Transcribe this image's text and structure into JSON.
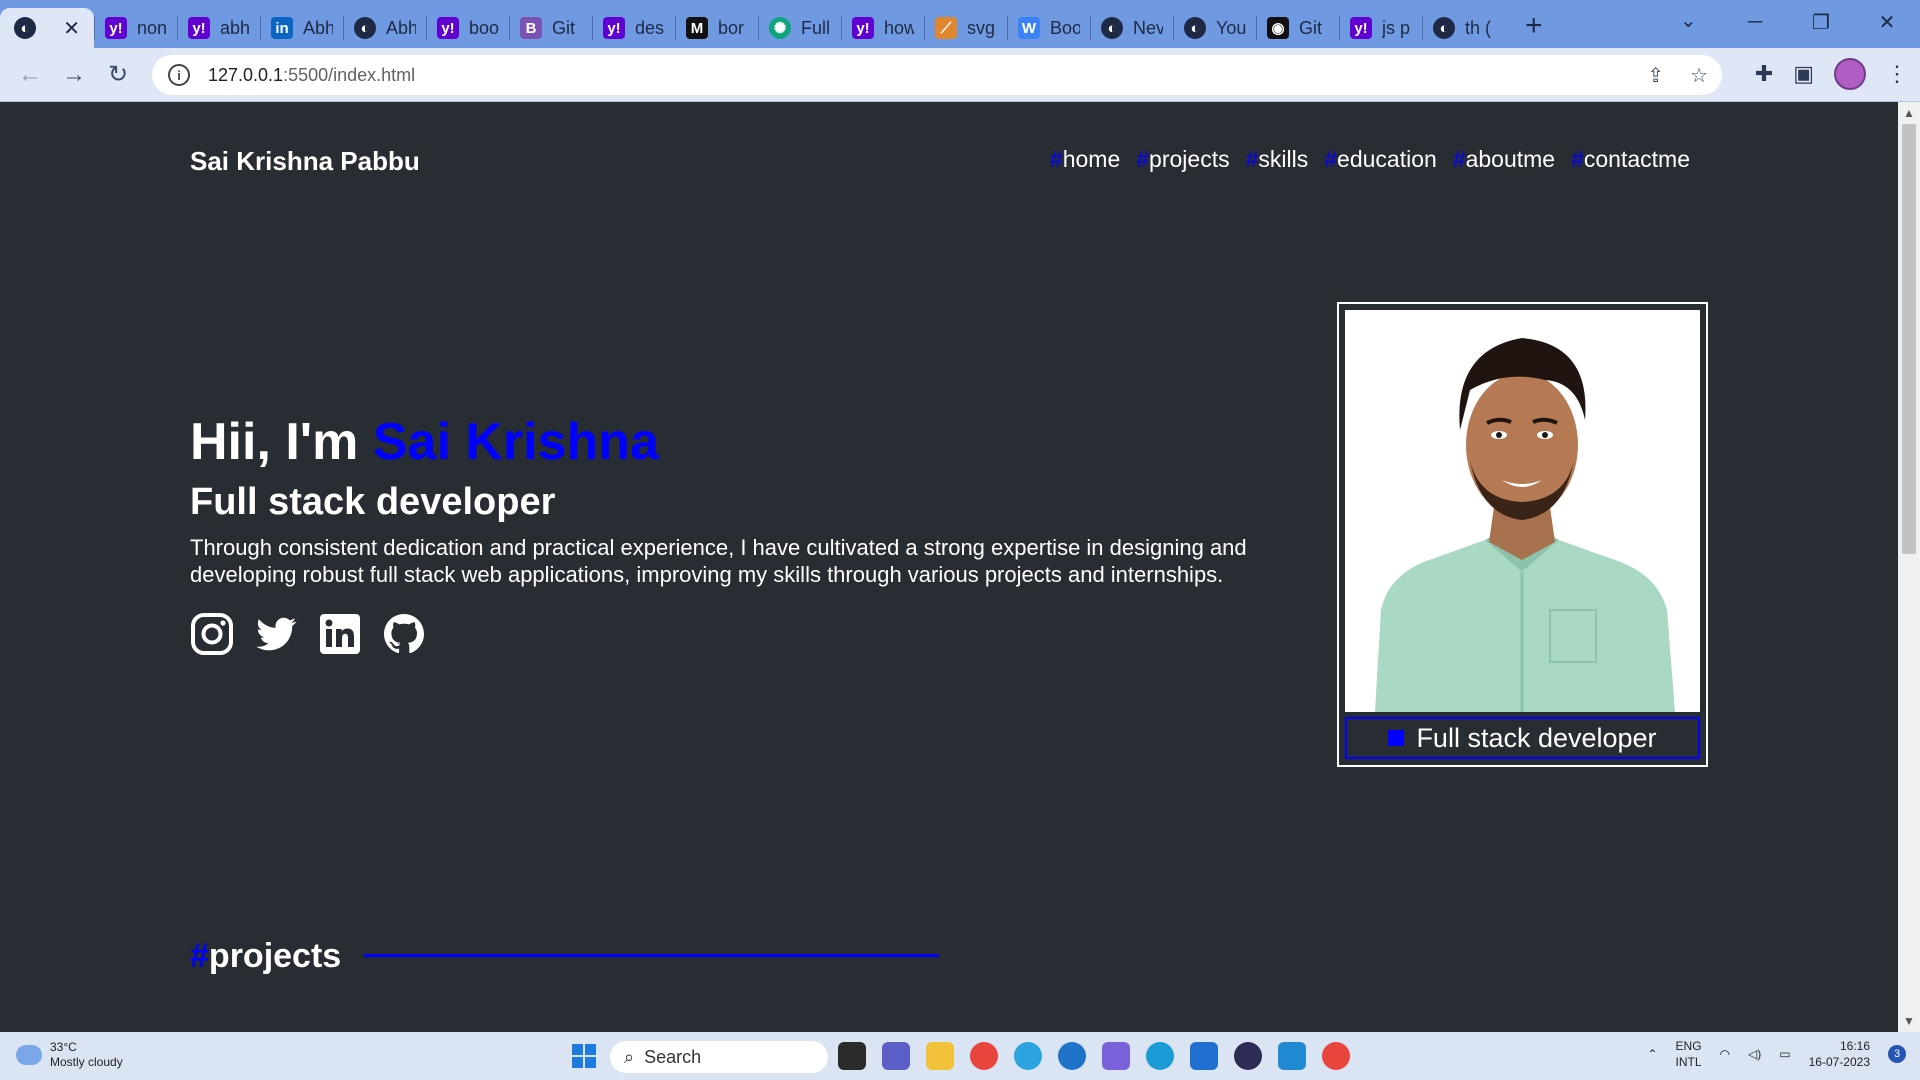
{
  "browser": {
    "tabs": [
      {
        "title": "",
        "icon": "globe-icon",
        "active": true
      },
      {
        "title": "non",
        "icon": "yahoo-icon"
      },
      {
        "title": "abh",
        "icon": "yahoo-icon"
      },
      {
        "title": "Abh",
        "icon": "linkedin-icon"
      },
      {
        "title": "Abh",
        "icon": "globe-icon"
      },
      {
        "title": "boo",
        "icon": "yahoo-icon"
      },
      {
        "title": "Git",
        "icon": "bootstrap-icon"
      },
      {
        "title": "des",
        "icon": "yahoo-icon"
      },
      {
        "title": "bor",
        "icon": "medium-icon"
      },
      {
        "title": "Full",
        "icon": "chatgpt-icon"
      },
      {
        "title": "how",
        "icon": "yahoo-icon"
      },
      {
        "title": "svg",
        "icon": "svg-icon"
      },
      {
        "title": "Boo",
        "icon": "wix-icon"
      },
      {
        "title": "Nev",
        "icon": "globe-icon"
      },
      {
        "title": "You",
        "icon": "globe-icon"
      },
      {
        "title": "Git",
        "icon": "github-icon"
      },
      {
        "title": "js p",
        "icon": "yahoo-icon"
      },
      {
        "title": "th (",
        "icon": "globe-icon"
      }
    ],
    "url_host": "127.0.0.1",
    "url_rest": ":5500/index.html"
  },
  "site": {
    "brand": "Sai Krishna Pabbu",
    "nav": [
      "home",
      "projects",
      "skills",
      "education",
      "aboutme",
      "contactme"
    ],
    "hash_symbol": "#",
    "hero": {
      "greeting": "Hii, I'm ",
      "name": "Sai Krishna",
      "role": "Full stack developer",
      "bio": "Through consistent dedication and practical experience, I have cultivated a strong expertise in designing and developing robust full stack web applications, improving my skills through various projects and internships."
    },
    "socials": [
      "instagram-icon",
      "twitter-icon",
      "linkedin-icon",
      "github-icon"
    ],
    "photo_caption": "Full stack developer",
    "section_title": "projects",
    "accent_color": "#0000ff",
    "background_color": "#282c33"
  },
  "taskbar": {
    "weather_temp": "33°C",
    "weather_desc": "Mostly cloudy",
    "search_label": "Search",
    "lang_top": "ENG",
    "lang_bottom": "INTL",
    "time": "16:16",
    "date": "16-07-2023",
    "notification_count": "3"
  }
}
